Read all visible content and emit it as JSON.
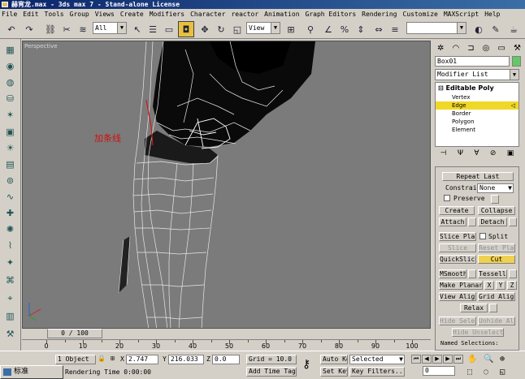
{
  "window": {
    "title": "赫宵龙.max - 3ds max 7 - Stand-alone License"
  },
  "menu": [
    "File",
    "Edit",
    "Tools",
    "Group",
    "Views",
    "Create",
    "Modifiers",
    "Character",
    "reactor",
    "Animation",
    "Graph Editors",
    "Rendering",
    "Customize",
    "MAXScript",
    "Help"
  ],
  "toolbar": {
    "undo_icon": "undo-icon",
    "redo_icon": "redo-icon",
    "selection_filter": "All",
    "ref_coord": "View",
    "named_sel_placeholder": ""
  },
  "viewport": {
    "label": "Perspective",
    "annotation": "加条线"
  },
  "command_panel": {
    "object_name": "Box01",
    "object_color": "#64c864",
    "modifier_list": "Modifier List",
    "stack": {
      "root": "Editable Poly",
      "items": [
        "Vertex",
        "Edge",
        "Border",
        "Polygon",
        "Element"
      ],
      "selected": "Edge"
    },
    "rollout": {
      "repeat_last": "Repeat Last",
      "constraints_label": "Constraints:",
      "constraints_value": "None",
      "preserve": "Preserve",
      "create": "Create",
      "collapse": "Collapse",
      "attach": "Attach",
      "detach": "Detach",
      "slice_plane": "Slice Plane",
      "split": "Split",
      "slice": "Slice",
      "reset_plane": "Reset Plane",
      "quickslice": "QuickSlice",
      "cut": "Cut",
      "msmooth": "MSmooth",
      "tessellate": "Tessellate",
      "make_planar": "Make Planar",
      "x": "X",
      "y": "Y",
      "z": "Z",
      "view_align": "View Align",
      "grid_align": "Grid Align",
      "relax": "Relax",
      "hide_selected": "Hide Selected",
      "unhide_all": "Unhide All",
      "hide_unselected": "Hide Unselected",
      "named_selections": "Named Selections:"
    }
  },
  "timeline": {
    "slider": "0 / 100",
    "ticks": [
      "0",
      "10",
      "20",
      "30",
      "40",
      "50",
      "60",
      "70",
      "80",
      "90",
      "100"
    ]
  },
  "status": {
    "objects": "1 Object",
    "x_label": "X",
    "x": "2.747",
    "y_label": "Y",
    "y": "216.033",
    "z_label": "Z",
    "z": "0.0",
    "grid": "Grid = 10.0",
    "rendering_time": "Rendering Time  0:00:00",
    "add_time_tag": "Add Time Tag",
    "auto_key": "Auto Key",
    "set_key": "Set Key",
    "selected": "Selected",
    "key_filters": "Key Filters...",
    "frame": "0"
  },
  "taskbar": {
    "ime": "标准"
  }
}
